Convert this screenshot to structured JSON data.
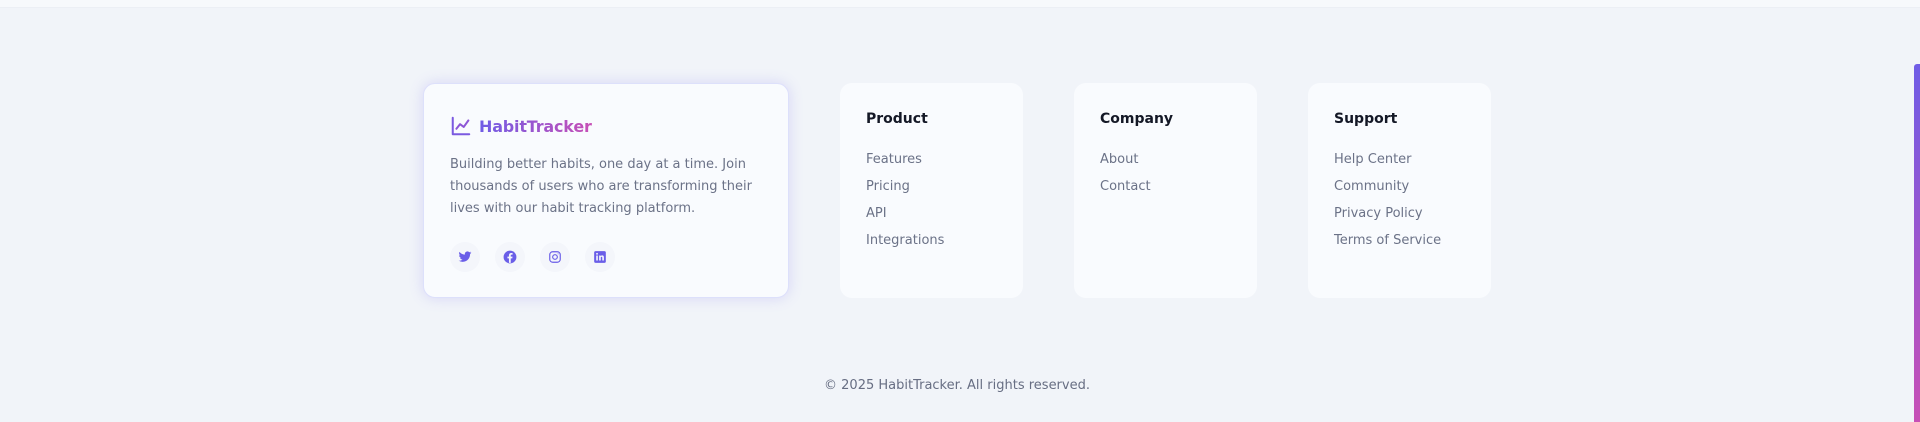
{
  "brand": {
    "name": "HabitTracker",
    "icon": "trend-chart-icon",
    "description": "Building better habits, one day at a time. Join thousands of users who are transforming their lives with our habit tracking platform.",
    "social": [
      {
        "name": "twitter-icon"
      },
      {
        "name": "facebook-icon"
      },
      {
        "name": "instagram-icon"
      },
      {
        "name": "linkedin-icon"
      }
    ]
  },
  "columns": [
    {
      "title": "Product",
      "links": [
        "Features",
        "Pricing",
        "API",
        "Integrations"
      ]
    },
    {
      "title": "Company",
      "links": [
        "About",
        "Contact"
      ]
    },
    {
      "title": "Support",
      "links": [
        "Help Center",
        "Community",
        "Privacy Policy",
        "Terms of Service"
      ]
    }
  ],
  "copyright": "© 2025 HabitTracker. All rights reserved.",
  "colors": {
    "accent_start": "#6f5ce6",
    "accent_end": "#c74fb6",
    "icon": "#6a5ee8"
  }
}
